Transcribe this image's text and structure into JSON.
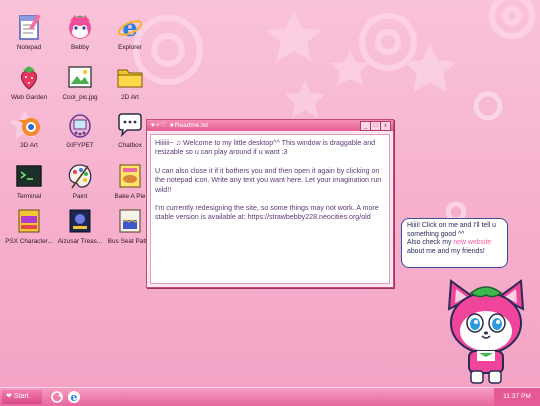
{
  "desktop": {
    "icons": [
      {
        "label": "Notepad",
        "icon": "notepad-icon"
      },
      {
        "label": "Bebby",
        "icon": "bebby-icon"
      },
      {
        "label": "Explorer",
        "icon": "explorer-icon"
      },
      {
        "label": "Web Garden",
        "icon": "strawberry-icon"
      },
      {
        "label": "Cool_pic.jpg",
        "icon": "image-icon"
      },
      {
        "label": "2D Art",
        "icon": "folder-icon"
      },
      {
        "label": "3D Art",
        "icon": "blender-icon"
      },
      {
        "label": "GIFYPET",
        "icon": "tamagotchi-icon"
      },
      {
        "label": "Chatbox",
        "icon": "chat-icon"
      },
      {
        "label": "Terminal",
        "icon": "terminal-icon"
      },
      {
        "label": "Paint",
        "icon": "paint-icon"
      },
      {
        "label": "Bake A Pie",
        "icon": "pie-icon"
      },
      {
        "label": "PSX Character...",
        "icon": "psx-icon"
      },
      {
        "label": "Aizusar Treas...",
        "icon": "treasure-icon"
      },
      {
        "label": "Bus Seat Patt...",
        "icon": "bus-seat-icon"
      }
    ]
  },
  "window": {
    "title": "Readme.txt",
    "title_icons": "♥✧♡",
    "title_star": "★",
    "paragraphs": [
      "Hiiiiii~ ♫ Welcome to my little desktop^^ This window is draggable and resizable so u can play around if u want :3",
      "U can also close it if it bothers you and then open it again by clicking on the notepad icon. Write any text you want here. Let your imagination run wild!!",
      "I'm currently redesigning the site, so some things may not work. A more stable version is available at: https://strawbebby228.neocities.org/old"
    ],
    "buttons": {
      "minimize": "_",
      "maximize": "□",
      "close": "x"
    }
  },
  "bubble": {
    "line1": "Hiiii! Click on me and I'll tell u something good ^^",
    "line2_pre": "Also check my ",
    "line2_link": "new website",
    "line2_post": " about me and my friends!"
  },
  "taskbar": {
    "start_label": "Start",
    "clock": "11:37 PM",
    "icons": [
      "refresh-icon",
      "explorer-icon"
    ]
  },
  "colors": {
    "desktop_pink": "#f6b0cc",
    "accent": "#e45d93",
    "text_purple": "#5b3a77",
    "link_pink": "#ff5aa1"
  }
}
